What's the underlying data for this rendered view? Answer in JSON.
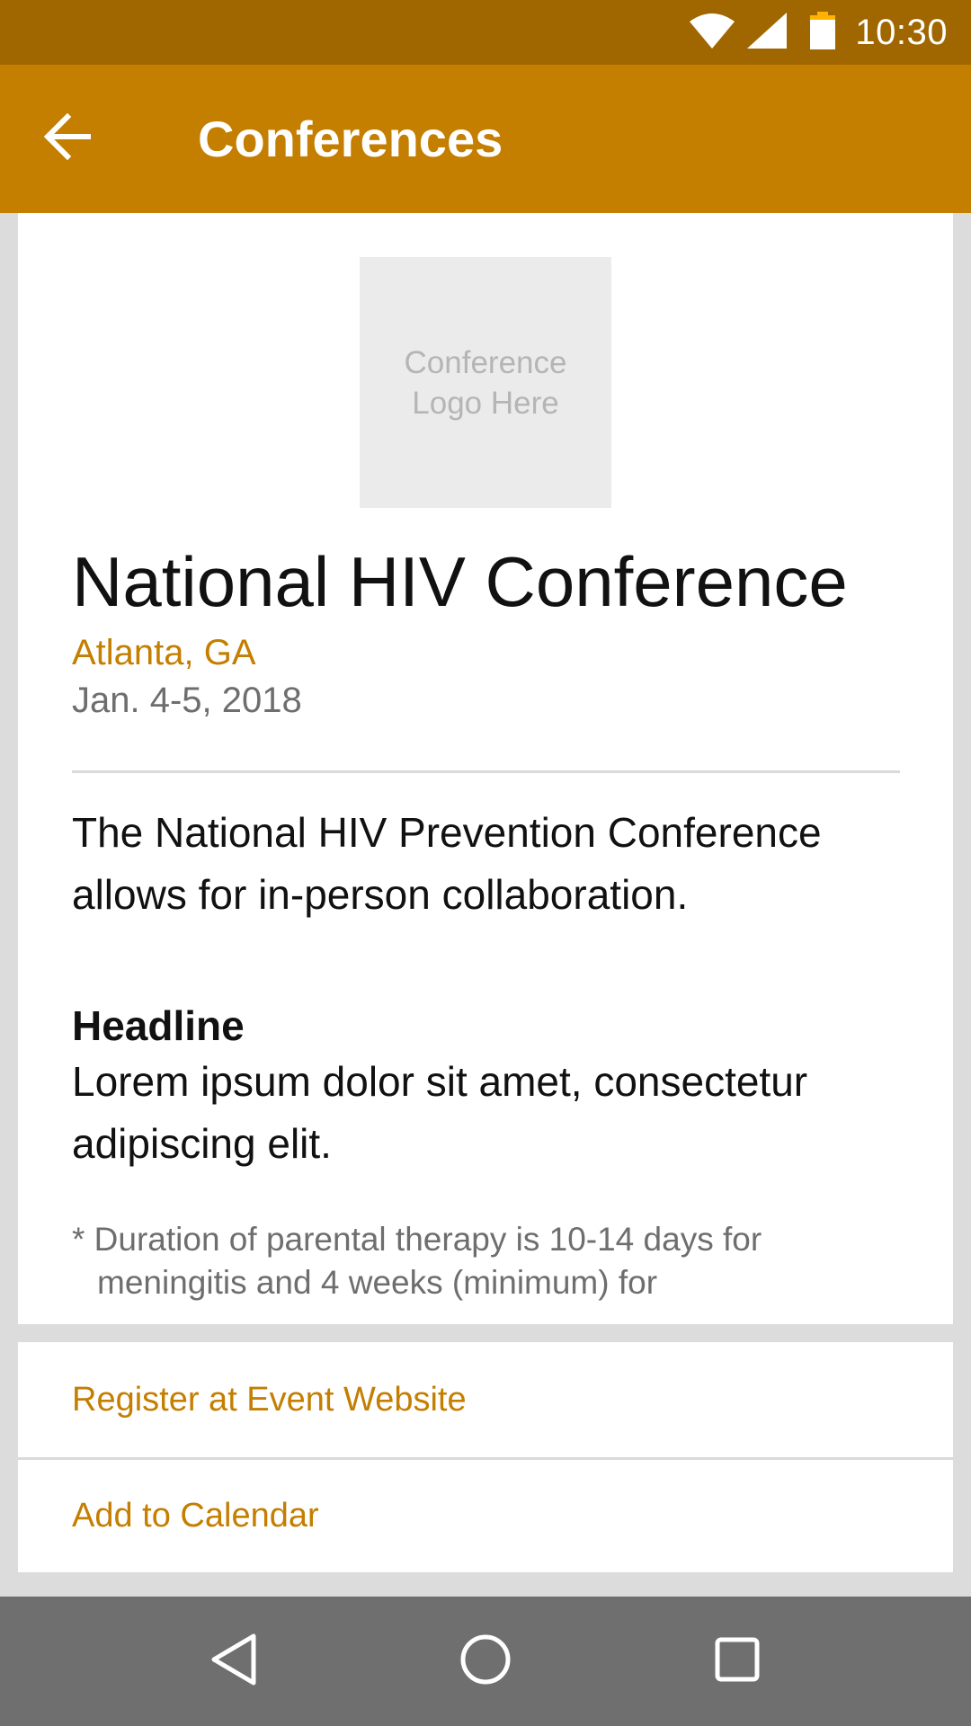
{
  "status_bar": {
    "time": "10:30",
    "icons": [
      "wifi-icon",
      "cell-signal-icon",
      "battery-icon"
    ]
  },
  "app_bar": {
    "title": "Conferences",
    "back_icon": "arrow-back-icon"
  },
  "conference": {
    "logo_placeholder": "Conference Logo Here",
    "title": "National HIV Conference",
    "location": "Atlanta, GA",
    "date": "Jan. 4-5, 2018",
    "description": "The National HIV Prevention Conference allows for in-person collaboration.",
    "headline": "Headline",
    "headline_body": "Lorem ipsum dolor sit amet, consectetur adipiscing elit.",
    "footnote": "* Duration of parental therapy is 10-14 days for meningitis and 4 weeks (minimum) for"
  },
  "actions": {
    "register_label": "Register at Event Website",
    "calendar_label": "Add to Calendar"
  },
  "nav_bar": {
    "icons": [
      "back-triangle-icon",
      "home-circle-icon",
      "recents-square-icon"
    ]
  },
  "colors": {
    "status_bar": "#a06700",
    "app_bar": "#c47e00",
    "accent": "#c47e00",
    "nav_bar": "#6f6f6f",
    "background": "#dcdcdc"
  }
}
